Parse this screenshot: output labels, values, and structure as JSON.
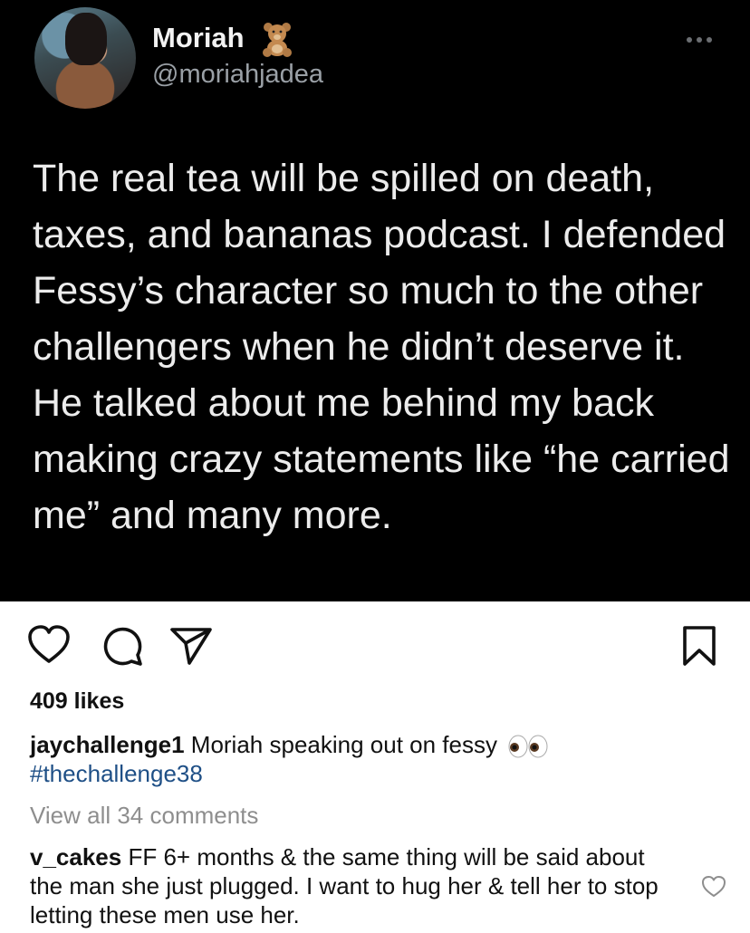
{
  "tweet": {
    "author_name": "Moriah",
    "handle": "@moriahjadea",
    "name_emoji": "teddy-bear",
    "text": "The real tea will be spilled on death, taxes, and bananas podcast. I defended Fessy’s character so much to the other challengers when he didn’t deserve it. He talked about me behind my back making crazy statements like “he carried me” and many more."
  },
  "post": {
    "likes": "409 likes",
    "caption_user": "jaychallenge1",
    "caption_text": "Moriah speaking out on fessy",
    "caption_emoji": "eyes",
    "hashtag": "#thechallenge38",
    "view_all_comments": "View all 34 comments"
  },
  "comment": {
    "user": "v_cakes",
    "text": "FF 6+ months & the same thing will be said about the man she just plugged.  I want to hug her & tell her to stop letting these men use her."
  },
  "icons": [
    "heart-icon",
    "comment-icon",
    "share-icon",
    "bookmark-icon",
    "more-icon"
  ]
}
